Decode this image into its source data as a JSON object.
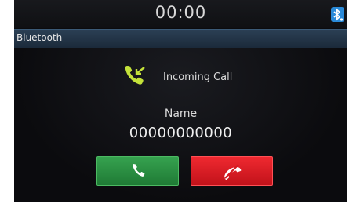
{
  "status_bar": {
    "time": "00:00",
    "bluetooth_icon": "bluetooth-connected-icon"
  },
  "title_bar": {
    "title": "Bluetooth"
  },
  "call": {
    "status_icon": "incoming-call-icon",
    "status_label": "Incoming Call",
    "caller_name": "Name",
    "caller_number": "00000000000"
  },
  "actions": {
    "accept_icon": "phone-accept-icon",
    "reject_icon": "phone-reject-icon"
  },
  "colors": {
    "accept": "#2a8e42",
    "reject": "#e0161f",
    "incoming_icon": "#c4e23a",
    "bluetooth": "#2a8ad8"
  }
}
